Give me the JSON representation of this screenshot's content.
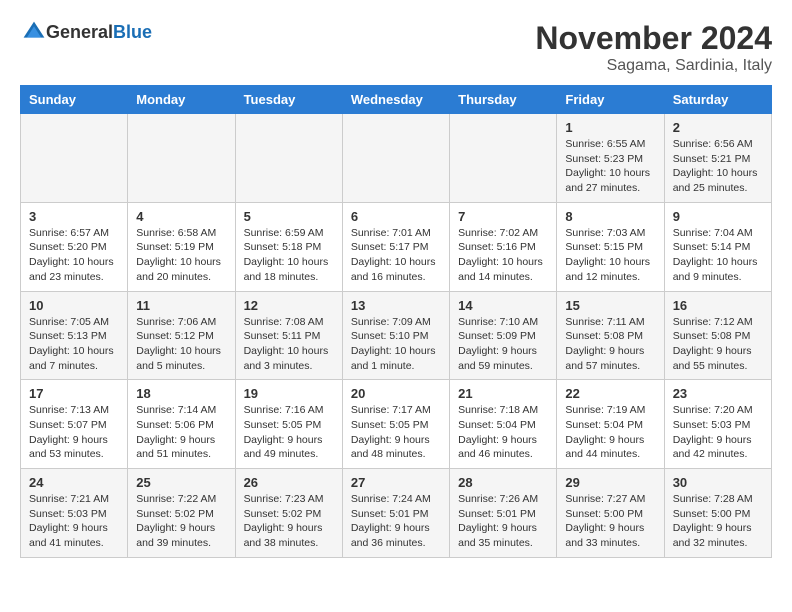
{
  "header": {
    "logo_general": "General",
    "logo_blue": "Blue",
    "month_year": "November 2024",
    "location": "Sagama, Sardinia, Italy"
  },
  "weekdays": [
    "Sunday",
    "Monday",
    "Tuesday",
    "Wednesday",
    "Thursday",
    "Friday",
    "Saturday"
  ],
  "weeks": [
    [
      {
        "day": "",
        "info": ""
      },
      {
        "day": "",
        "info": ""
      },
      {
        "day": "",
        "info": ""
      },
      {
        "day": "",
        "info": ""
      },
      {
        "day": "",
        "info": ""
      },
      {
        "day": "1",
        "info": "Sunrise: 6:55 AM\nSunset: 5:23 PM\nDaylight: 10 hours and 27 minutes."
      },
      {
        "day": "2",
        "info": "Sunrise: 6:56 AM\nSunset: 5:21 PM\nDaylight: 10 hours and 25 minutes."
      }
    ],
    [
      {
        "day": "3",
        "info": "Sunrise: 6:57 AM\nSunset: 5:20 PM\nDaylight: 10 hours and 23 minutes."
      },
      {
        "day": "4",
        "info": "Sunrise: 6:58 AM\nSunset: 5:19 PM\nDaylight: 10 hours and 20 minutes."
      },
      {
        "day": "5",
        "info": "Sunrise: 6:59 AM\nSunset: 5:18 PM\nDaylight: 10 hours and 18 minutes."
      },
      {
        "day": "6",
        "info": "Sunrise: 7:01 AM\nSunset: 5:17 PM\nDaylight: 10 hours and 16 minutes."
      },
      {
        "day": "7",
        "info": "Sunrise: 7:02 AM\nSunset: 5:16 PM\nDaylight: 10 hours and 14 minutes."
      },
      {
        "day": "8",
        "info": "Sunrise: 7:03 AM\nSunset: 5:15 PM\nDaylight: 10 hours and 12 minutes."
      },
      {
        "day": "9",
        "info": "Sunrise: 7:04 AM\nSunset: 5:14 PM\nDaylight: 10 hours and 9 minutes."
      }
    ],
    [
      {
        "day": "10",
        "info": "Sunrise: 7:05 AM\nSunset: 5:13 PM\nDaylight: 10 hours and 7 minutes."
      },
      {
        "day": "11",
        "info": "Sunrise: 7:06 AM\nSunset: 5:12 PM\nDaylight: 10 hours and 5 minutes."
      },
      {
        "day": "12",
        "info": "Sunrise: 7:08 AM\nSunset: 5:11 PM\nDaylight: 10 hours and 3 minutes."
      },
      {
        "day": "13",
        "info": "Sunrise: 7:09 AM\nSunset: 5:10 PM\nDaylight: 10 hours and 1 minute."
      },
      {
        "day": "14",
        "info": "Sunrise: 7:10 AM\nSunset: 5:09 PM\nDaylight: 9 hours and 59 minutes."
      },
      {
        "day": "15",
        "info": "Sunrise: 7:11 AM\nSunset: 5:08 PM\nDaylight: 9 hours and 57 minutes."
      },
      {
        "day": "16",
        "info": "Sunrise: 7:12 AM\nSunset: 5:08 PM\nDaylight: 9 hours and 55 minutes."
      }
    ],
    [
      {
        "day": "17",
        "info": "Sunrise: 7:13 AM\nSunset: 5:07 PM\nDaylight: 9 hours and 53 minutes."
      },
      {
        "day": "18",
        "info": "Sunrise: 7:14 AM\nSunset: 5:06 PM\nDaylight: 9 hours and 51 minutes."
      },
      {
        "day": "19",
        "info": "Sunrise: 7:16 AM\nSunset: 5:05 PM\nDaylight: 9 hours and 49 minutes."
      },
      {
        "day": "20",
        "info": "Sunrise: 7:17 AM\nSunset: 5:05 PM\nDaylight: 9 hours and 48 minutes."
      },
      {
        "day": "21",
        "info": "Sunrise: 7:18 AM\nSunset: 5:04 PM\nDaylight: 9 hours and 46 minutes."
      },
      {
        "day": "22",
        "info": "Sunrise: 7:19 AM\nSunset: 5:04 PM\nDaylight: 9 hours and 44 minutes."
      },
      {
        "day": "23",
        "info": "Sunrise: 7:20 AM\nSunset: 5:03 PM\nDaylight: 9 hours and 42 minutes."
      }
    ],
    [
      {
        "day": "24",
        "info": "Sunrise: 7:21 AM\nSunset: 5:03 PM\nDaylight: 9 hours and 41 minutes."
      },
      {
        "day": "25",
        "info": "Sunrise: 7:22 AM\nSunset: 5:02 PM\nDaylight: 9 hours and 39 minutes."
      },
      {
        "day": "26",
        "info": "Sunrise: 7:23 AM\nSunset: 5:02 PM\nDaylight: 9 hours and 38 minutes."
      },
      {
        "day": "27",
        "info": "Sunrise: 7:24 AM\nSunset: 5:01 PM\nDaylight: 9 hours and 36 minutes."
      },
      {
        "day": "28",
        "info": "Sunrise: 7:26 AM\nSunset: 5:01 PM\nDaylight: 9 hours and 35 minutes."
      },
      {
        "day": "29",
        "info": "Sunrise: 7:27 AM\nSunset: 5:00 PM\nDaylight: 9 hours and 33 minutes."
      },
      {
        "day": "30",
        "info": "Sunrise: 7:28 AM\nSunset: 5:00 PM\nDaylight: 9 hours and 32 minutes."
      }
    ]
  ]
}
